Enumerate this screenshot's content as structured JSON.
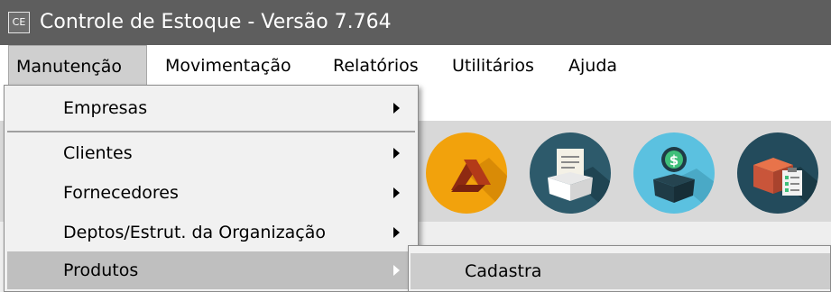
{
  "window": {
    "icon_text": "CE",
    "title": "Controle de Estoque - Versão 7.764"
  },
  "menubar": {
    "items": [
      {
        "label": "Manutenção",
        "active": true
      },
      {
        "label": "Movimentação"
      },
      {
        "label": "Relatórios"
      },
      {
        "label": "Utilitários"
      },
      {
        "label": "Ajuda"
      }
    ]
  },
  "dropdown": {
    "items": [
      {
        "label": "Empresas",
        "has_submenu": true
      },
      {
        "label": "Clientes",
        "has_submenu": true
      },
      {
        "label": "Fornecedores",
        "has_submenu": true
      },
      {
        "label": "Deptos/Estrut. da Organização",
        "has_submenu": true
      },
      {
        "label": "Produtos",
        "has_submenu": true,
        "highlighted": true
      }
    ]
  },
  "submenu": {
    "items": [
      {
        "label": "Cadastra",
        "highlighted": true
      }
    ]
  },
  "toolbar": {
    "icons": [
      {
        "name": "drive-icon",
        "color": "#f2a20c"
      },
      {
        "name": "document-box-icon",
        "color": "#2d5a6b"
      },
      {
        "name": "money-box-icon",
        "color": "#5bc1e0"
      },
      {
        "name": "inventory-checklist-icon",
        "color": "#234b5c"
      }
    ]
  },
  "colors": {
    "titlebar": "#5e5e5e",
    "menu_bg": "#f1f1f1",
    "highlight": "#bfbfbf",
    "toolbar_bg": "#d8d8d8"
  }
}
